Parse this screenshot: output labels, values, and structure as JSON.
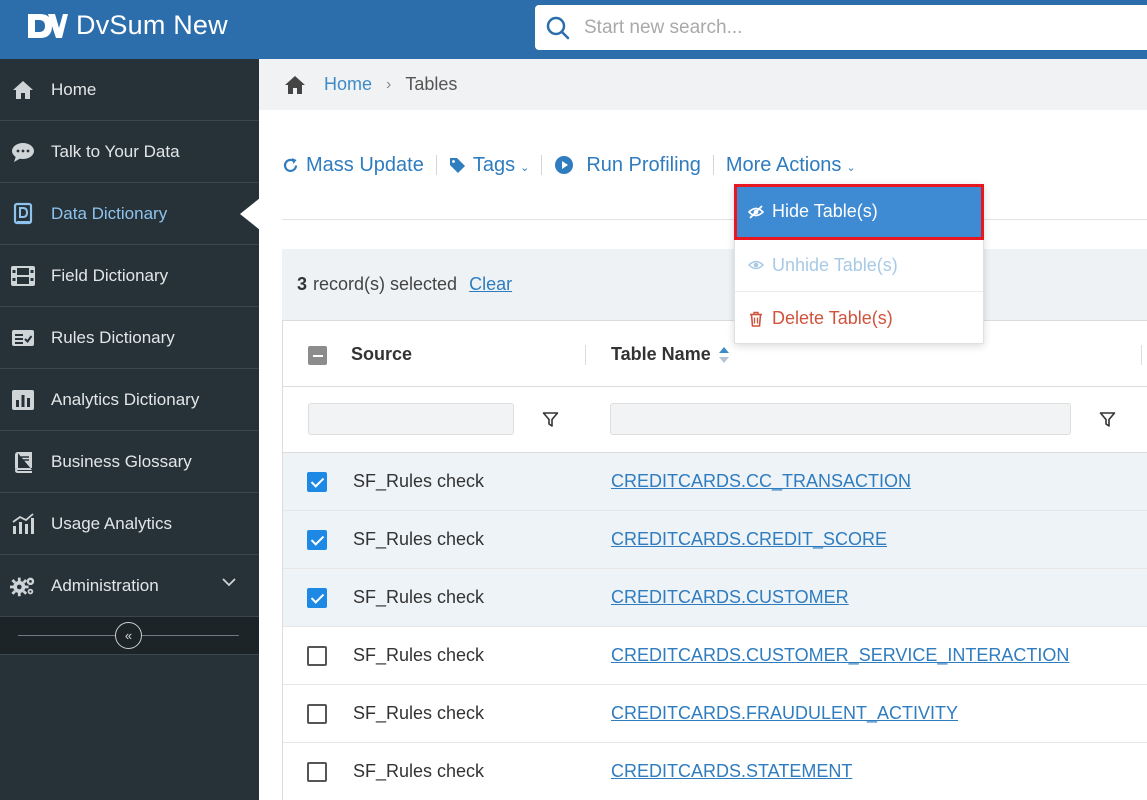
{
  "app": {
    "name": "DvSum New",
    "accent": "#2c6eab"
  },
  "search": {
    "placeholder": "Start new search..."
  },
  "sidebar": {
    "items": [
      {
        "label": "Home",
        "icon": "home-icon"
      },
      {
        "label": "Talk to Your Data",
        "icon": "chat-icon"
      },
      {
        "label": "Data Dictionary",
        "icon": "dictionary-icon",
        "active": true
      },
      {
        "label": "Field Dictionary",
        "icon": "field-icon"
      },
      {
        "label": "Rules Dictionary",
        "icon": "rules-icon"
      },
      {
        "label": "Analytics Dictionary",
        "icon": "analytics-icon"
      },
      {
        "label": "Business Glossary",
        "icon": "book-icon"
      },
      {
        "label": "Usage Analytics",
        "icon": "usage-chart-icon"
      },
      {
        "label": "Administration",
        "icon": "gears-icon"
      }
    ]
  },
  "breadcrumb": {
    "home": "Home",
    "current": "Tables"
  },
  "toolbar": {
    "mass_update": "Mass Update",
    "tags": "Tags",
    "run_profiling": "Run Profiling",
    "more_actions": "More Actions"
  },
  "dropdown": {
    "hide": "Hide Table(s)",
    "unhide": "Unhide Table(s)",
    "delete": "Delete Table(s)"
  },
  "selection": {
    "count": "3",
    "text": "record(s) selected",
    "clear": "Clear"
  },
  "table": {
    "columns": {
      "source": "Source",
      "table_name": "Table Name"
    },
    "rows": [
      {
        "source": "SF_Rules check",
        "table_name": "CREDITCARDS.CC_TRANSACTION",
        "checked": true
      },
      {
        "source": "SF_Rules check",
        "table_name": "CREDITCARDS.CREDIT_SCORE",
        "checked": true
      },
      {
        "source": "SF_Rules check",
        "table_name": "CREDITCARDS.CUSTOMER",
        "checked": true
      },
      {
        "source": "SF_Rules check",
        "table_name": "CREDITCARDS.CUSTOMER_SERVICE_INTERACTION",
        "checked": false
      },
      {
        "source": "SF_Rules check",
        "table_name": "CREDITCARDS.FRAUDULENT_ACTIVITY",
        "checked": false
      },
      {
        "source": "SF_Rules check",
        "table_name": "CREDITCARDS.STATEMENT",
        "checked": false
      }
    ]
  }
}
